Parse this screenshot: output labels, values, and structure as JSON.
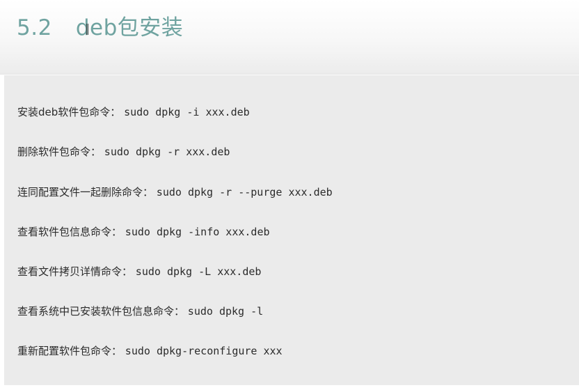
{
  "header": {
    "section_number": "5.2",
    "section_title": "deb包安装"
  },
  "commands": [
    {
      "label": "安装deb软件包命令：",
      "command": "sudo dpkg -i xxx.deb"
    },
    {
      "label": "删除软件包命令：",
      "command": " sudo dpkg -r xxx.deb"
    },
    {
      "label": "连同配置文件一起删除命令：",
      "command": "sudo dpkg -r --purge xxx.deb"
    },
    {
      "label": "查看软件包信息命令：",
      "command": "sudo dpkg -info xxx.deb"
    },
    {
      "label": "查看文件拷贝详情命令：",
      "command": "sudo dpkg -L xxx.deb"
    },
    {
      "label": "查看系统中已安装软件包信息命令：",
      "command": "sudo dpkg -l"
    },
    {
      "label": "重新配置软件包命令：",
      "command": " sudo dpkg-reconfigure xxx"
    }
  ]
}
